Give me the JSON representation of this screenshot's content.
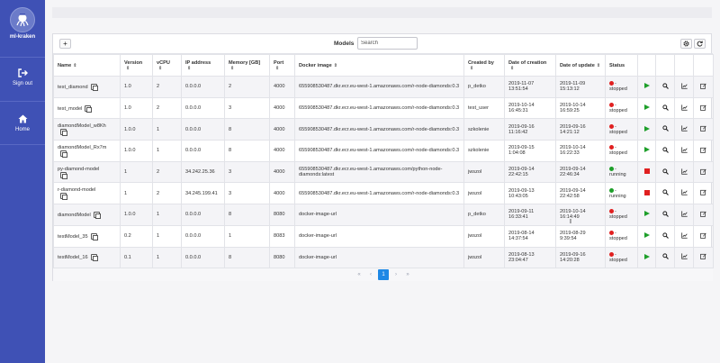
{
  "app": {
    "logo_text": "ml-kraken"
  },
  "sidebar": {
    "items": [
      {
        "label": "Sign out",
        "icon": "sign-out-icon"
      },
      {
        "label": "Home",
        "icon": "home-icon"
      }
    ]
  },
  "toolbar": {
    "models_label": "Models",
    "search_placeholder": "Search",
    "add_icon": "plus-icon",
    "settings_icon": "gear-icon",
    "refresh_icon": "refresh-icon"
  },
  "table": {
    "headers": {
      "name": "Name",
      "version": "Version",
      "vcpu": "vCPU",
      "ip": "IP address",
      "memory": "Memory [GB]",
      "port": "Port",
      "image": "Docker image",
      "created_by": "Created by",
      "date_creation": "Date of creation",
      "date_update": "Date of update",
      "status": "Status"
    },
    "rows": [
      {
        "name": "test_diamond",
        "version": "1.0",
        "vcpu": "2",
        "ip": "0.0.0.0",
        "memory": "2",
        "port": "4000",
        "image": "655908530487.dkr.ecr.eu-west-1.amazonaws.com/r-node-diamonds:0.3",
        "created_by": "p_detko",
        "created": "2019-11-07 13:51:54",
        "updated": "2019-11-09 15:13:12",
        "status": "- stopped",
        "running": false
      },
      {
        "name": "test_model",
        "version": "1.0",
        "vcpu": "2",
        "ip": "0.0.0.0",
        "memory": "3",
        "port": "4000",
        "image": "655908530487.dkr.ecr.eu-west-1.amazonaws.com/r-node-diamonds:0.3",
        "created_by": "test_user",
        "created": "2019-10-14 16:45:31",
        "updated": "2019-10-14 16:59:25",
        "status": "- stopped",
        "running": false
      },
      {
        "name": "diamondModel_w8Kh",
        "version": "1.0.0",
        "vcpu": "1",
        "ip": "0.0.0.0",
        "memory": "8",
        "port": "4000",
        "image": "655908530487.dkr.ecr.eu-west-1.amazonaws.com/r-node-diamonds:0.3",
        "created_by": "szkolenie",
        "created": "2019-09-16 11:16:42",
        "updated": "2019-09-16 14:21:12",
        "status": "- stopped",
        "running": false
      },
      {
        "name": "diamondModel_Rx7m",
        "version": "1.0.0",
        "vcpu": "1",
        "ip": "0.0.0.0",
        "memory": "8",
        "port": "4000",
        "image": "655908530487.dkr.ecr.eu-west-1.amazonaws.com/r-node-diamonds:0.3",
        "created_by": "szkolenie",
        "created": "2019-09-15 1:04:08",
        "updated": "2019-10-14 16:22:33",
        "status": "- stopped",
        "running": false
      },
      {
        "name": "py-diamond-model",
        "version": "1",
        "vcpu": "2",
        "ip": "34.242.25.36",
        "memory": "3",
        "port": "4000",
        "image": "655908530487.dkr.ecr.eu-west-1.amazonaws.com/python-node-diamonds:latest",
        "created_by": "jwszol",
        "created": "2019-09-14 22:42:15",
        "updated": "2019-09-14 22:46:34",
        "status": "- running",
        "running": true
      },
      {
        "name": "r-diamond-model",
        "version": "1",
        "vcpu": "2",
        "ip": "34.245.199.41",
        "memory": "3",
        "port": "4000",
        "image": "655908530487.dkr.ecr.eu-west-1.amazonaws.com/r-node-diamonds:0.3",
        "created_by": "jwszol",
        "created": "2019-09-13 10:43:05",
        "updated": "2019-09-14 22:42:58",
        "status": "- running",
        "running": true
      },
      {
        "name": "diamondModel",
        "version": "1.0.0",
        "vcpu": "1",
        "ip": "0.0.0.0",
        "memory": "8",
        "port": "8080",
        "image": "docker-image-url",
        "created_by": "p_detko",
        "created": "2019-09-11 16:33:41",
        "updated": "2019-10-14 16:14:49",
        "status": "- stopped",
        "running": false
      },
      {
        "name": "testModel_35",
        "version": "0.2",
        "vcpu": "1",
        "ip": "0.0.0.0",
        "memory": "1",
        "port": "8083",
        "image": "docker-image-url",
        "created_by": "jwszol",
        "created": "2019-08-14 14:37:54",
        "updated": "2019-08-29 9:39:54",
        "status": "- stopped",
        "running": false
      },
      {
        "name": "testModel_16",
        "version": "0.1",
        "vcpu": "1",
        "ip": "0.0.0.0",
        "memory": "8",
        "port": "8080",
        "image": "docker-image-url",
        "created_by": "jwszol",
        "created": "2019-08-13 23:04:47",
        "updated": "2019-09-16 14:20:28",
        "status": "- stopped",
        "running": false
      }
    ]
  },
  "pagination": {
    "first": "«",
    "prev": "‹",
    "current": "1",
    "next": "›",
    "last": "»"
  },
  "colors": {
    "sidebar": "#3f51b5",
    "running": "#1e9f2a",
    "stopped": "#e02020",
    "page_active": "#1e88e5"
  }
}
